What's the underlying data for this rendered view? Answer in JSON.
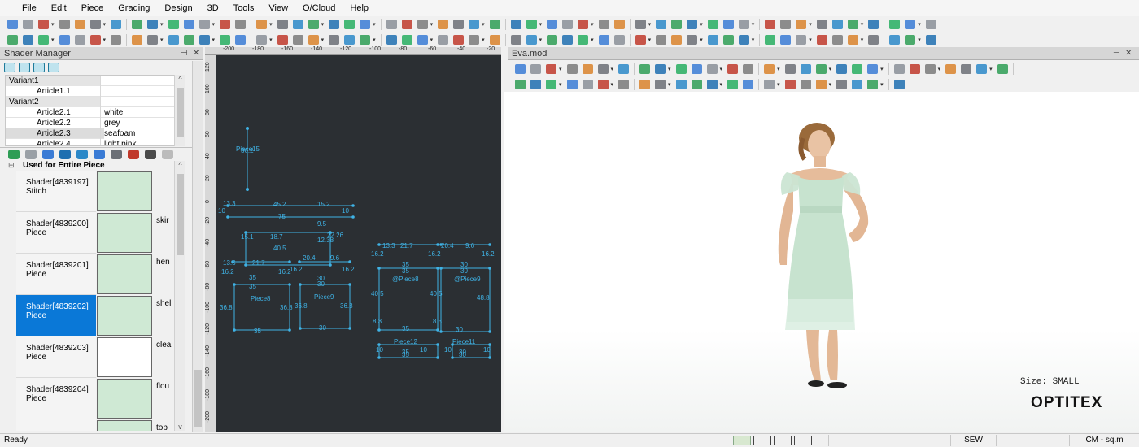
{
  "menu": [
    "File",
    "Edit",
    "Piece",
    "Grading",
    "Design",
    "3D",
    "Tools",
    "View",
    "O/Cloud",
    "Help"
  ],
  "shader_manager": {
    "title": "Shader Manager",
    "pin_icon": "pin-icon",
    "close_icon": "close-icon",
    "variants": [
      {
        "name": "Variant1",
        "value": "",
        "expander": "⊟",
        "indent": 0
      },
      {
        "name": "Article1.1",
        "value": "",
        "expander": "",
        "indent": 1
      },
      {
        "name": "Variant2",
        "value": "",
        "expander": "⊟",
        "indent": 0
      },
      {
        "name": "Article2.1",
        "value": "white",
        "expander": "",
        "indent": 1
      },
      {
        "name": "Article2.2",
        "value": "grey",
        "expander": "",
        "indent": 1
      },
      {
        "name": "Article2.3",
        "value": "seafoam",
        "expander": "",
        "indent": 1,
        "selected": true
      },
      {
        "name": "Article2.4",
        "value": "light pink",
        "expander": "",
        "indent": 1
      }
    ],
    "group_label": "Used for Entire Piece",
    "shaders": [
      {
        "name": "Shader[4839197]",
        "type": "Stitch",
        "extra": "",
        "swatch": "#cfe9d4"
      },
      {
        "name": "Shader[4839200]",
        "type": "Piece",
        "extra": "skir",
        "swatch": "#cfe9d4"
      },
      {
        "name": "Shader[4839201]",
        "type": "Piece",
        "extra": "hen",
        "swatch": "#cfe9d4"
      },
      {
        "name": "Shader[4839202]",
        "type": "Piece",
        "extra": "shell",
        "swatch": "#cfe9d4",
        "selected": true
      },
      {
        "name": "Shader[4839203]",
        "type": "Piece",
        "extra": "clea",
        "swatch": "#ffffff"
      },
      {
        "name": "Shader[4839204]",
        "type": "Piece",
        "extra": "flou",
        "swatch": "#cfe9d4"
      },
      {
        "name": "",
        "type": "",
        "extra": "top",
        "swatch": "#cfe9d4"
      }
    ]
  },
  "pattern_view": {
    "ruler_top": [
      "-200",
      "-180",
      "-160",
      "-140",
      "-120",
      "-100",
      "-80",
      "-60",
      "-40",
      "-20"
    ],
    "ruler_left": [
      "120",
      "100",
      "80",
      "60",
      "40",
      "20",
      "0",
      "-20",
      "-40",
      "-60",
      "-80",
      "-100",
      "-120",
      "-140",
      "-160",
      "-180",
      "-200"
    ],
    "labels": [
      {
        "t": "Piece15"
      },
      {
        "t": "36.2"
      },
      {
        "t": "13.3"
      },
      {
        "t": "45.2"
      },
      {
        "t": "15.2"
      },
      {
        "t": "10"
      },
      {
        "t": "10"
      },
      {
        "t": "75"
      },
      {
        "t": "13.3"
      },
      {
        "t": "21.7"
      },
      {
        "t": "16.2"
      },
      {
        "t": "16.2"
      },
      {
        "t": "35"
      },
      {
        "t": "35"
      },
      {
        "t": "Piece8"
      },
      {
        "t": "36.8"
      },
      {
        "t": "36.8"
      },
      {
        "t": "35"
      },
      {
        "t": "20.4"
      },
      {
        "t": "9.6"
      },
      {
        "t": "16.2"
      },
      {
        "t": "16.2"
      },
      {
        "t": "30"
      },
      {
        "t": "30"
      },
      {
        "t": "Piece9"
      },
      {
        "t": "36.8"
      },
      {
        "t": "36.8"
      },
      {
        "t": "30"
      },
      {
        "t": "13.3"
      },
      {
        "t": "21.7"
      },
      {
        "t": "20.4"
      },
      {
        "t": "9.6"
      },
      {
        "t": "16.2"
      },
      {
        "t": "16.2"
      },
      {
        "t": "16.2"
      },
      {
        "t": "35"
      },
      {
        "t": "35"
      },
      {
        "t": "30"
      },
      {
        "t": "30"
      },
      {
        "t": "@Piece8"
      },
      {
        "t": "@Piece9"
      },
      {
        "t": "40.5"
      },
      {
        "t": "40.5"
      },
      {
        "t": "48.8"
      },
      {
        "t": "8.3"
      },
      {
        "t": "8.3"
      },
      {
        "t": "35"
      },
      {
        "t": "30"
      },
      {
        "t": "Piece12"
      },
      {
        "t": "Piece11"
      },
      {
        "t": "35"
      },
      {
        "t": "35"
      },
      {
        "t": "30"
      },
      {
        "t": "30"
      },
      {
        "t": "10"
      },
      {
        "t": "10"
      },
      {
        "t": "10"
      },
      {
        "t": "10"
      },
      {
        "t": "12.38"
      },
      {
        "t": "22.26"
      },
      {
        "t": "18.7"
      },
      {
        "t": "40.5"
      },
      {
        "t": "15.1"
      },
      {
        "t": "9.5"
      }
    ]
  },
  "model_view": {
    "title": "Eva.mod",
    "size_label": "Size: SMALL",
    "brand": "OPTITEX"
  },
  "status": {
    "text": "Ready",
    "mode": "SEW",
    "units": "CM - sq.m"
  },
  "colors": {
    "pattern_bg": "#2b2f33",
    "pattern_line": "#3fb3e6",
    "selection": "#0a78d7",
    "dress": "#c7e3cf"
  }
}
